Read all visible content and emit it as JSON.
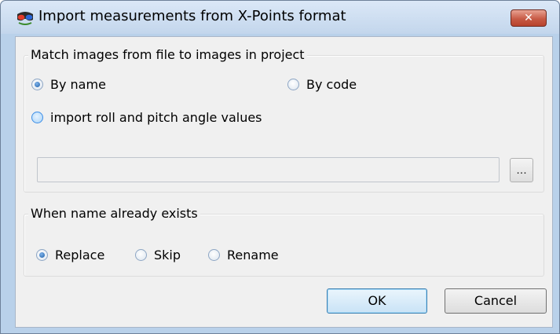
{
  "window": {
    "title": "Import measurements from X-Points format",
    "close_label": "✕",
    "icon": "3d-glasses-icon"
  },
  "match_group": {
    "label": "Match images from file to images in project",
    "by_name": {
      "label": "By name",
      "checked": true
    },
    "by_code": {
      "label": "By code",
      "checked": false
    },
    "import_roll_pitch": {
      "label": "import roll and pitch angle values",
      "checked": false
    },
    "file_path": {
      "value": ""
    },
    "browse_label": "..."
  },
  "exists_group": {
    "label": "When name already exists",
    "options": [
      {
        "label": "Replace",
        "checked": true
      },
      {
        "label": "Skip",
        "checked": false
      },
      {
        "label": "Rename",
        "checked": false
      }
    ]
  },
  "buttons": {
    "ok": "OK",
    "cancel": "Cancel"
  }
}
